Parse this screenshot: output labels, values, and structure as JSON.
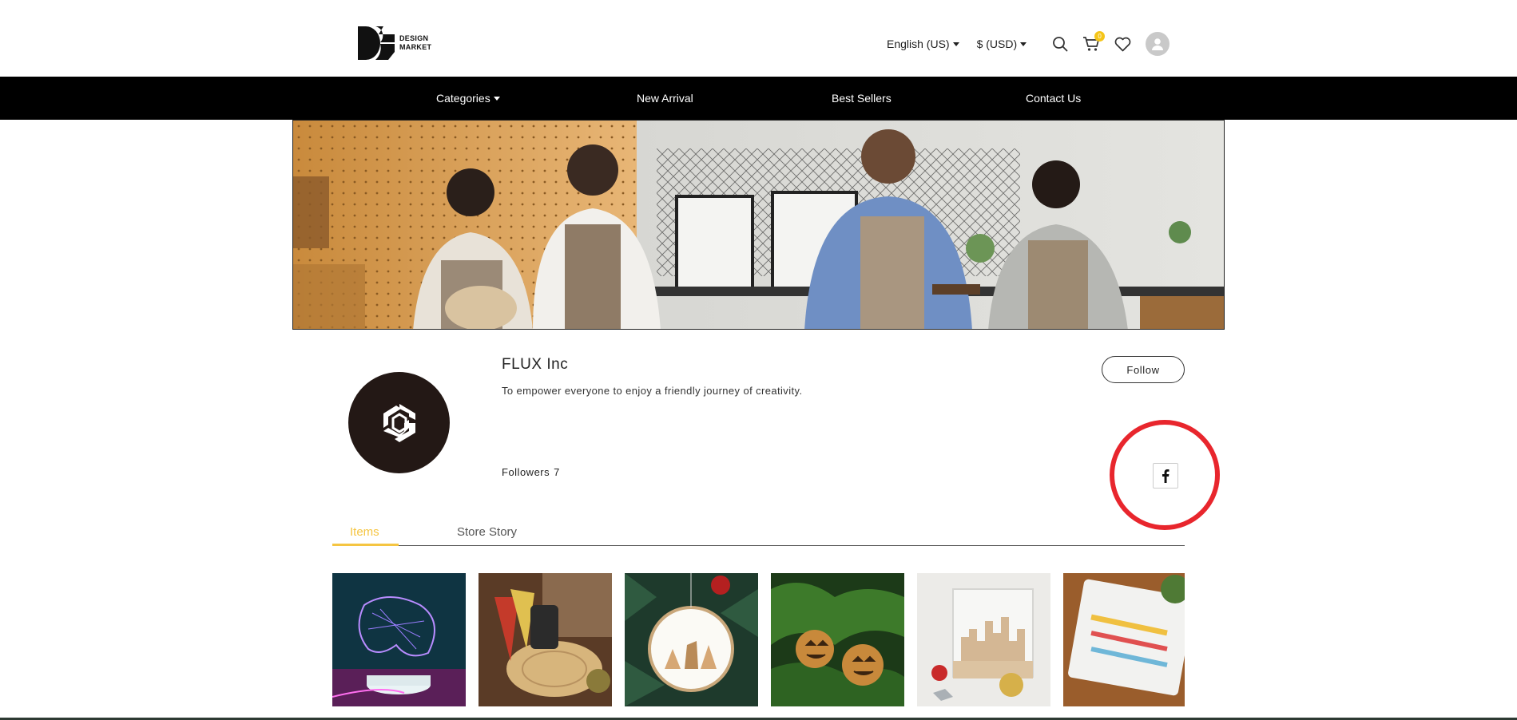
{
  "header": {
    "logo_text_line1": "DESIGN",
    "logo_text_line2": "MARKET",
    "language": "English (US)",
    "currency": "$ (USD)",
    "cart_count": "0",
    "accent_color": "#f5c518"
  },
  "nav": {
    "items": [
      {
        "label": "Categories",
        "has_dropdown": true
      },
      {
        "label": "New Arrival"
      },
      {
        "label": "Best Sellers"
      },
      {
        "label": "Contact Us"
      }
    ]
  },
  "store": {
    "name": "FLUX Inc",
    "description": "To empower everyone to enjoy a friendly journey of creativity.",
    "followers_label": "Followers",
    "followers_count": "7",
    "follow_button": "Follow",
    "social_icon": "facebook-icon"
  },
  "tabs": [
    {
      "label": "Items",
      "active": true
    },
    {
      "label": "Store Story",
      "active": false
    }
  ],
  "products": [
    {
      "name": "wireframe-controller-lamp"
    },
    {
      "name": "wooden-keychains"
    },
    {
      "name": "deer-ornament"
    },
    {
      "name": "pumpkin-ornaments"
    },
    {
      "name": "acrylic-town-display"
    },
    {
      "name": "acrylic-tray"
    }
  ],
  "colors": {
    "nav_bg": "#000000",
    "tab_active": "#f5c542",
    "highlight_circle": "#e8262d"
  }
}
